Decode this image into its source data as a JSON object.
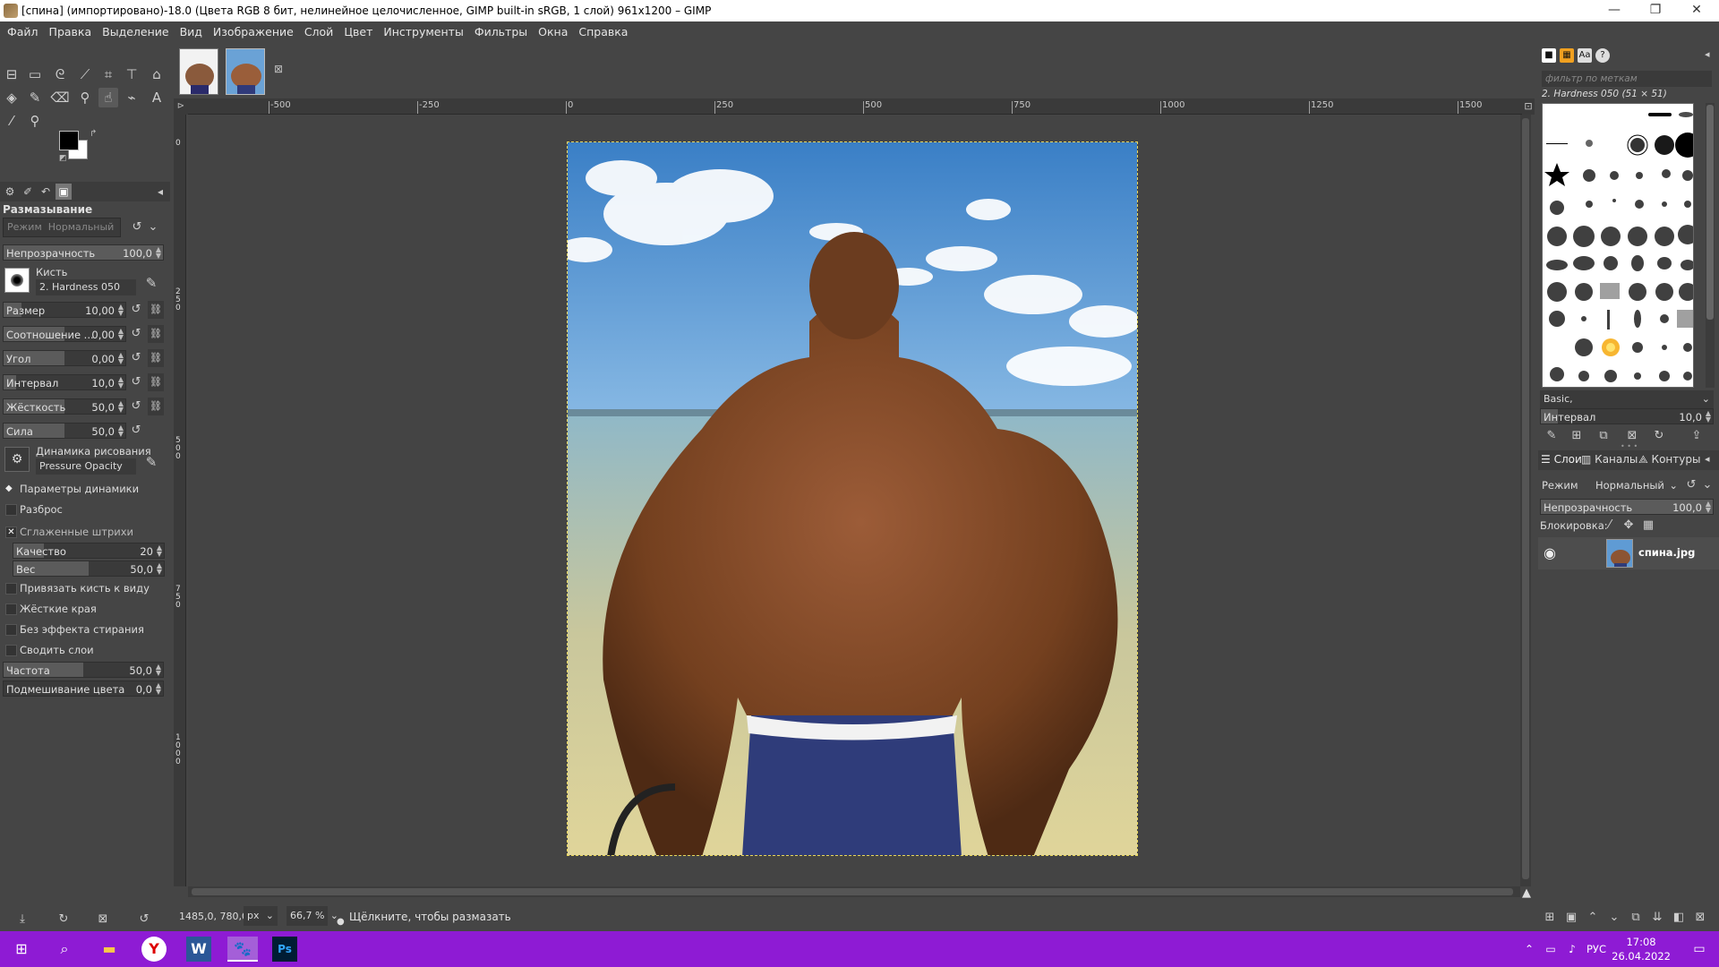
{
  "window": {
    "title": "[спина] (импортировано)-18.0 (Цвета RGB 8 бит, нелинейное целочисленное, GIMP built-in sRGB, 1 слой) 961x1200 – GIMP",
    "minimize": "—",
    "restore": "❐",
    "close": "✕"
  },
  "menu": [
    "Файл",
    "Правка",
    "Выделение",
    "Вид",
    "Изображение",
    "Слой",
    "Цвет",
    "Инструменты",
    "Фильтры",
    "Окна",
    "Справка"
  ],
  "tool_options": {
    "title": "Размазывание",
    "mode_label": "Режим",
    "mode_value": "Нормальный",
    "opacity": {
      "label": "Непрозрачность",
      "value": "100,0",
      "level": 1.0
    },
    "brush_label": "Кисть",
    "brush_value": "2. Hardness 050",
    "size": {
      "label": "Размер",
      "value": "10,00",
      "level": 0.15
    },
    "ratio": {
      "label": "Соотношение ...",
      "value": "0,00",
      "level": 0.5
    },
    "angle": {
      "label": "Угол",
      "value": "0,00",
      "level": 0.5
    },
    "spacing": {
      "label": "Интервал",
      "value": "10,0",
      "level": 0.1
    },
    "hardness": {
      "label": "Жёсткость",
      "value": "50,0",
      "level": 0.5
    },
    "force": {
      "label": "Сила",
      "value": "50,0",
      "level": 0.5
    },
    "dynamics_label": "Динамика рисования",
    "dynamics_value": "Pressure Opacity",
    "dynamics_params": "Параметры динамики",
    "scatter": "Разброс",
    "smooth": "Сглаженные штрихи",
    "quality": {
      "label": "Качество",
      "value": "20",
      "level": 0.2
    },
    "weight": {
      "label": "Вес",
      "value": "50,0",
      "level": 0.5
    },
    "lock_brush": "Привязать кисть к виду",
    "hard_edges": "Жёсткие края",
    "no_erase": "Без эффекта стирания",
    "sample_merged": "Сводить слои",
    "rate": {
      "label": "Частота",
      "value": "50,0",
      "level": 0.5
    },
    "color_blend": {
      "label": "Подмешивание цвета",
      "value": "0,0",
      "level": 0.0
    }
  },
  "ruler": {
    "top_labels": [
      "-500",
      "-250",
      "0",
      "250",
      "500",
      "750",
      "1000",
      "1250",
      "1500"
    ],
    "left_labels": [
      "0",
      "2 5 0",
      "5 0 0",
      "7 5 0",
      "1 0 0 0"
    ]
  },
  "status": {
    "coords": "1485,0, 780,0",
    "unit": "px",
    "zoom": "66,7 %",
    "message": "Щёлкните, чтобы размазать"
  },
  "brushes": {
    "filter_placeholder": "фильтр по меткам",
    "selected_name": "2. Hardness 050 (51 × 51)",
    "preset": "Basic,",
    "spacing": {
      "label": "Интервал",
      "value": "10,0",
      "level": 0.1
    }
  },
  "layers": {
    "tabs": [
      "Слои",
      "Каналы",
      "Контуры"
    ],
    "mode_label": "Режим",
    "mode_value": "Нормальный",
    "opacity": {
      "label": "Непрозрачность",
      "value": "100,0",
      "level": 1.0
    },
    "lock_label": "Блокировка:",
    "items": [
      {
        "name": "спина.jpg"
      }
    ]
  },
  "taskbar": {
    "lang": "РУС",
    "time": "17:08",
    "date": "26.04.2022"
  }
}
